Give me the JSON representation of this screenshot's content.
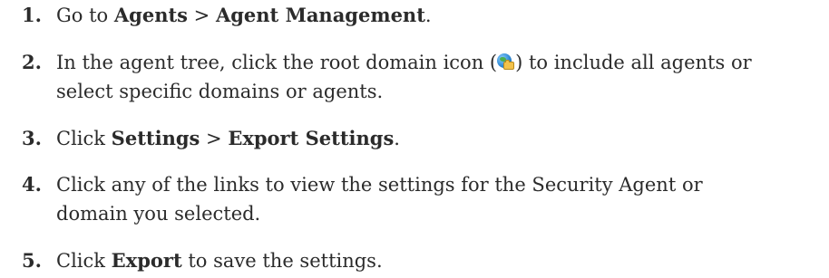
{
  "steps": [
    {
      "number": "1.",
      "parts": {
        "pre": "Go to ",
        "b1": "Agents",
        "sep": " > ",
        "b2": "Agent Management",
        "post": "."
      }
    },
    {
      "number": "2.",
      "parts": {
        "pre": "In the agent tree, click the root domain icon (",
        "icon_name": "root-domain-icon",
        "post_icon": ") to include all agents or",
        "line2": "select specific domains or agents."
      }
    },
    {
      "number": "3.",
      "parts": {
        "pre": "Click ",
        "b1": "Settings",
        "sep": " > ",
        "b2": "Export Settings",
        "post": "."
      }
    },
    {
      "number": "4.",
      "parts": {
        "line1": "Click any of the links to view the settings for the Security Agent or",
        "line2": "domain you selected."
      }
    },
    {
      "number": "5.",
      "parts": {
        "pre": "Click ",
        "b1": "Export",
        "post": " to save the settings."
      }
    }
  ],
  "colors": {
    "text": "#2b2b2b",
    "background": "#ffffff"
  }
}
